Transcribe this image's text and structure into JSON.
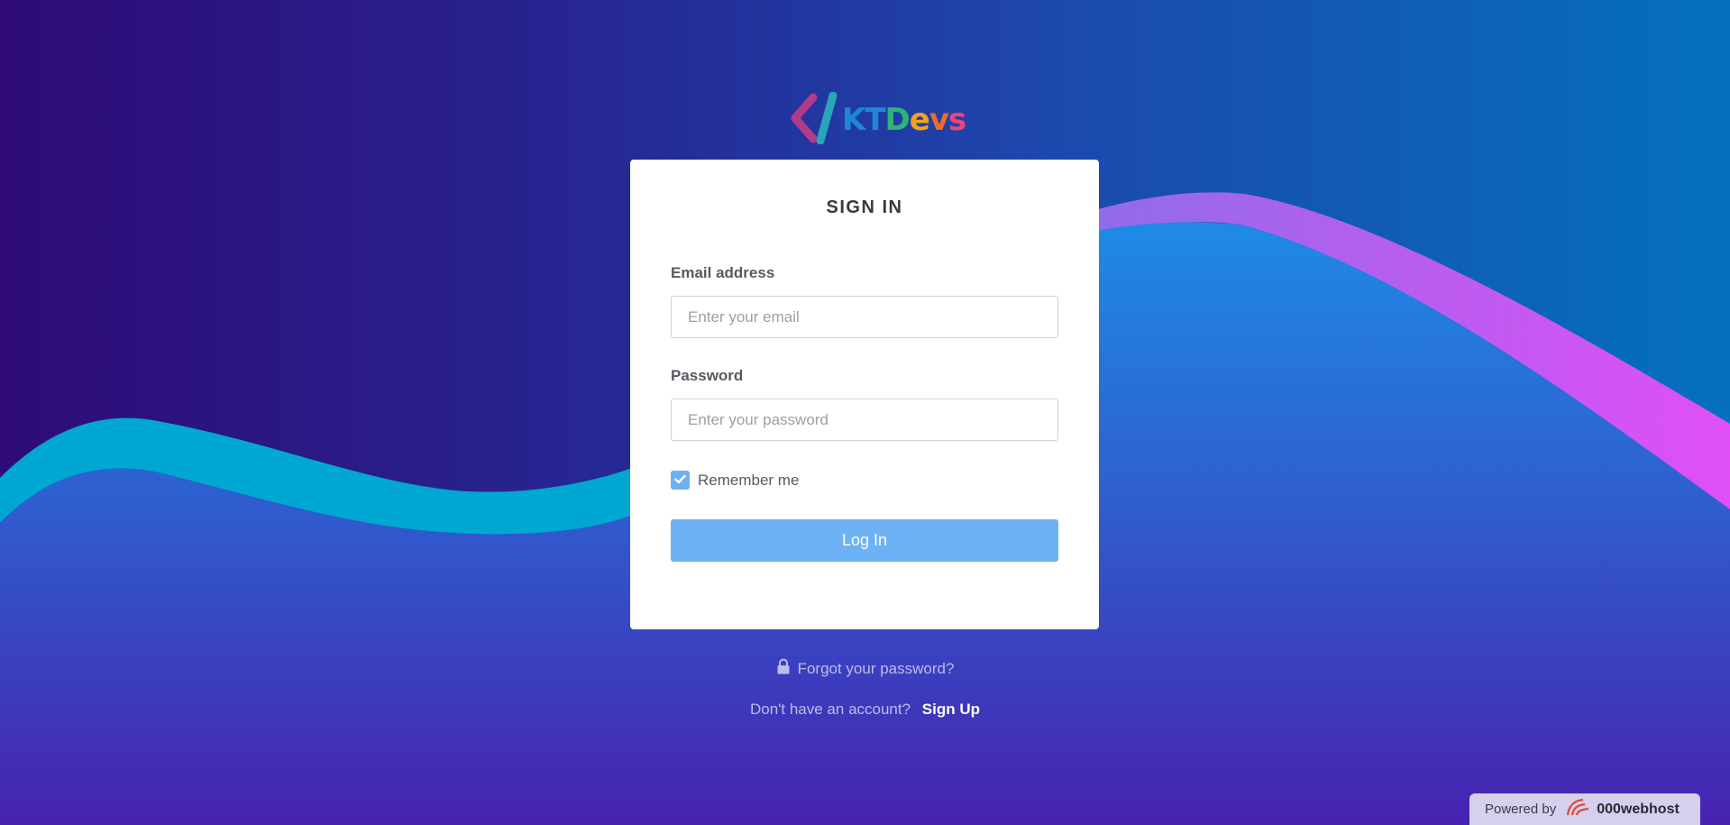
{
  "brand": {
    "logo_text_parts": [
      {
        "text": "KT",
        "color": "#1e88d8"
      },
      {
        "text": "D",
        "color": "#2bb673"
      },
      {
        "text": "e",
        "color": "#f0a21a"
      },
      {
        "text": "v",
        "color": "#ef6a2e"
      },
      {
        "text": "s",
        "color": "#e9457a"
      }
    ]
  },
  "form": {
    "title": "SIGN IN",
    "email_label": "Email address",
    "email_placeholder": "Enter your email",
    "email_value": "",
    "password_label": "Password",
    "password_placeholder": "Enter your password",
    "password_value": "",
    "remember_label": "Remember me",
    "remember_checked": true,
    "login_label": "Log In"
  },
  "links": {
    "forgot_password": "Forgot your password?",
    "no_account_text": "Don't have an account?",
    "signup_label": "Sign Up"
  },
  "footer_badge": {
    "prefix": "Powered by",
    "brand": "000webhost"
  },
  "icons": {
    "logo": "code-bracket-logo-icon",
    "lock": "lock-icon",
    "checkmark": "checkmark-icon",
    "host_logo": "000webhost-logo-icon"
  },
  "colors": {
    "button": "#6cb2f4",
    "checkbox": "#6eb0f2",
    "wave_cyan": "#00a7d3",
    "wave_magenta": "#d94ef7"
  }
}
